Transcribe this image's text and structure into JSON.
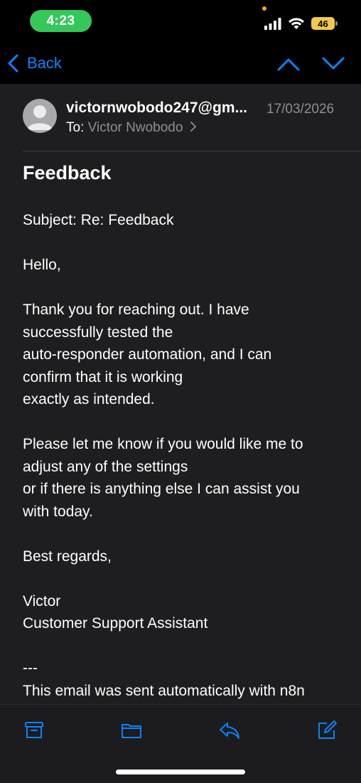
{
  "status_bar": {
    "time": "4:23",
    "battery": "46"
  },
  "nav": {
    "back_label": "Back"
  },
  "email": {
    "sender": "victornwobodo247@gm...",
    "date": "17/03/2026",
    "to_label": "To:",
    "recipient": "Victor Nwobodo",
    "title": "Feedback",
    "body": [
      "Subject: Re: Feedback",
      "",
      "Hello,",
      "",
      "Thank you for reaching out. I have",
      "successfully tested the",
      "auto-responder automation, and I can",
      "confirm that it is working",
      "exactly as intended.",
      "",
      "Please let me know if you would like me to",
      "adjust any of the settings",
      "or if there is anything else I can assist you",
      "with today.",
      "",
      "Best regards,",
      "",
      "Victor",
      "Customer Support Assistant",
      "",
      "---",
      "This email was sent automatically with n8n"
    ]
  },
  "toolbar": {
    "icons": [
      "archive-icon",
      "folder-icon",
      "reply-icon",
      "compose-icon"
    ]
  },
  "colors": {
    "accent": "#0a84ff",
    "time_pill": "#34c759",
    "battery": "#f2c94c",
    "background": "#1e1e20"
  }
}
